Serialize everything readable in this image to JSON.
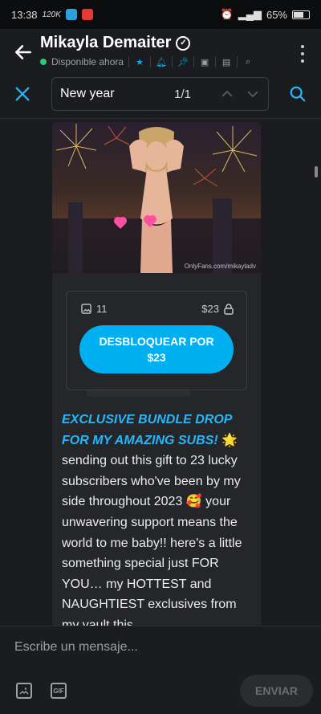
{
  "status_bar": {
    "time": "13:38",
    "speed": "120K",
    "battery": "65%"
  },
  "header": {
    "name": "Mikayla Demaiter",
    "status": "Disponible ahora"
  },
  "search": {
    "query": "New year",
    "count": "1/1"
  },
  "post": {
    "watermark": "OnlyFans.com/mikayladv",
    "media_count": "11",
    "price": "$23",
    "unlock_label_line1": "DESBLOQUEAR POR",
    "unlock_label_line2": "$23",
    "caption_highlight": "EXCLUSIVE BUNDLE DROP FOR MY AMAZING SUBS!",
    "caption_highlight_emoji": "🌟",
    "caption_text_1": "sending out this gift to 23 lucky subscribers who've been by my side throughout 2023",
    "caption_emoji": "🥰",
    "caption_text_2": "your unwavering support means the world to me baby!! here's a little something special just FOR YOU… my HOTTEST and NAUGHTIEST exclusives from my vault this"
  },
  "composer": {
    "placeholder": "Escribe un mensaje...",
    "gif_label": "GIF",
    "send_label": "ENVIAR"
  },
  "colors": {
    "accent": "#00aff0",
    "online": "#2ecc71",
    "background": "#1b1c1f"
  }
}
